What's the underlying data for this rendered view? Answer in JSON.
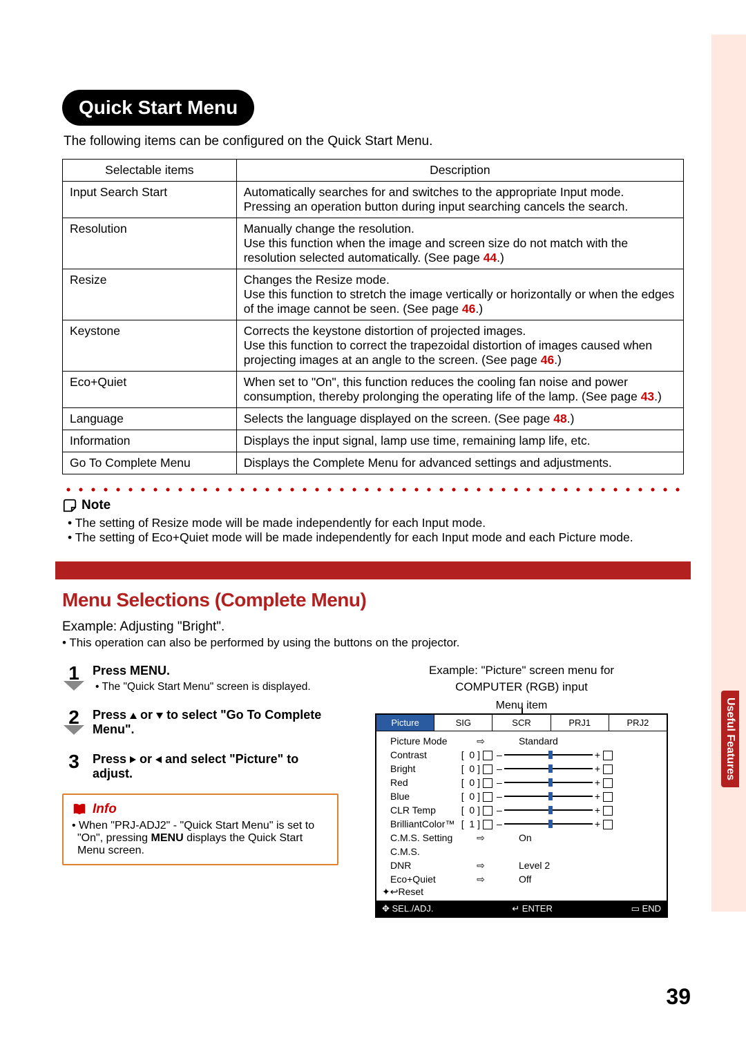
{
  "page_number": "39",
  "side_tab": "Useful\nFeatures",
  "title_pill": "Quick Start Menu",
  "intro": "The following items can be configured on the Quick Start Menu.",
  "table": {
    "headers": [
      "Selectable items",
      "Description"
    ],
    "rows": [
      {
        "item": "Input Search Start",
        "desc": "Automatically searches for and switches to the appropriate Input mode.\nPressing an operation button during input searching cancels the search.",
        "ref": ""
      },
      {
        "item": "Resolution",
        "desc": "Manually change the resolution.\nUse this function when the image and screen size do not match with the resolution selected automatically. (See page ",
        "ref": "44",
        "desc_after": ".)"
      },
      {
        "item": "Resize",
        "desc": "Changes the Resize mode.\nUse this function to stretch the image vertically or horizontally or when the edges of the image cannot be seen. (See page ",
        "ref": "46",
        "desc_after": ".)"
      },
      {
        "item": "Keystone",
        "desc": "Corrects the keystone distortion of projected images.\nUse this function to correct the trapezoidal distortion of images caused when projecting images at an angle to the screen. (See page ",
        "ref": "46",
        "desc_after": ".)"
      },
      {
        "item": "Eco+Quiet",
        "desc": "When set to \"On\", this function reduces the cooling fan noise and power consumption, thereby prolonging the operating life of the lamp. (See page ",
        "ref": "43",
        "desc_after": ".)"
      },
      {
        "item": "Language",
        "desc": "Selects the language displayed on the screen. (See page ",
        "ref": "48",
        "desc_after": ".)"
      },
      {
        "item": "Information",
        "desc": "Displays the input signal, lamp use time, remaining lamp life, etc.",
        "ref": ""
      },
      {
        "item": "Go To Complete Menu",
        "desc": "Displays the Complete Menu for advanced settings and adjustments.",
        "ref": ""
      }
    ]
  },
  "note": {
    "heading": "Note",
    "items": [
      "The setting of Resize mode will be made independently for each Input mode.",
      "The setting of Eco+Quiet mode will be made independently for each Input mode and each Picture mode."
    ]
  },
  "section_title": "Menu Selections (Complete Menu)",
  "example_line": "Example: Adjusting \"Bright\".",
  "sub_line": "This operation can also be performed by using the buttons on the projector.",
  "steps": [
    {
      "num": "1",
      "title_pre": "Press ",
      "title_bold": "MENU",
      "title_post": ".",
      "sub": "The \"Quick Start Menu\" screen is displayed."
    },
    {
      "num": "2",
      "title_pre": "Press ",
      "title_mid": " or ",
      "title_post": " to select \"Go To Complete Menu\"."
    },
    {
      "num": "3",
      "title_pre": "Press ",
      "title_mid": " or ",
      "title_post": " and select \"Picture\" to adjust."
    }
  ],
  "info": {
    "heading": "Info",
    "body": "When \"PRJ-ADJ2\" - \"Quick Start Menu\" is set to \"On\", pressing MENU displays the Quick Start Menu screen.",
    "bold_word": "MENU"
  },
  "osd_head1": "Example: \"Picture\" screen menu for",
  "osd_head2": "COMPUTER (RGB) input",
  "osd_menu_item_label": "Menu item",
  "osd": {
    "tabs": [
      "Picture",
      "SIG",
      "SCR",
      "PRJ1",
      "PRJ2"
    ],
    "active_tab": 0,
    "rows_top": {
      "label": "Picture Mode",
      "value": "Standard"
    },
    "sliders": [
      {
        "label": "Contrast",
        "val": "0"
      },
      {
        "label": "Bright",
        "val": "0"
      },
      {
        "label": "Red",
        "val": "0"
      },
      {
        "label": "Blue",
        "val": "0"
      },
      {
        "label": "CLR Temp",
        "val": "0"
      },
      {
        "label": "BrilliantColor™",
        "val": "1"
      }
    ],
    "plain_rows": [
      {
        "label": "C.M.S. Setting",
        "value": "On"
      },
      {
        "label": "C.M.S.",
        "value": ""
      },
      {
        "label": "DNR",
        "value": "Level 2"
      },
      {
        "label": "Eco+Quiet",
        "value": "Off"
      }
    ],
    "reset": "Reset",
    "footer": {
      "left": "SEL./ADJ.",
      "mid": "ENTER",
      "right": "END"
    }
  }
}
